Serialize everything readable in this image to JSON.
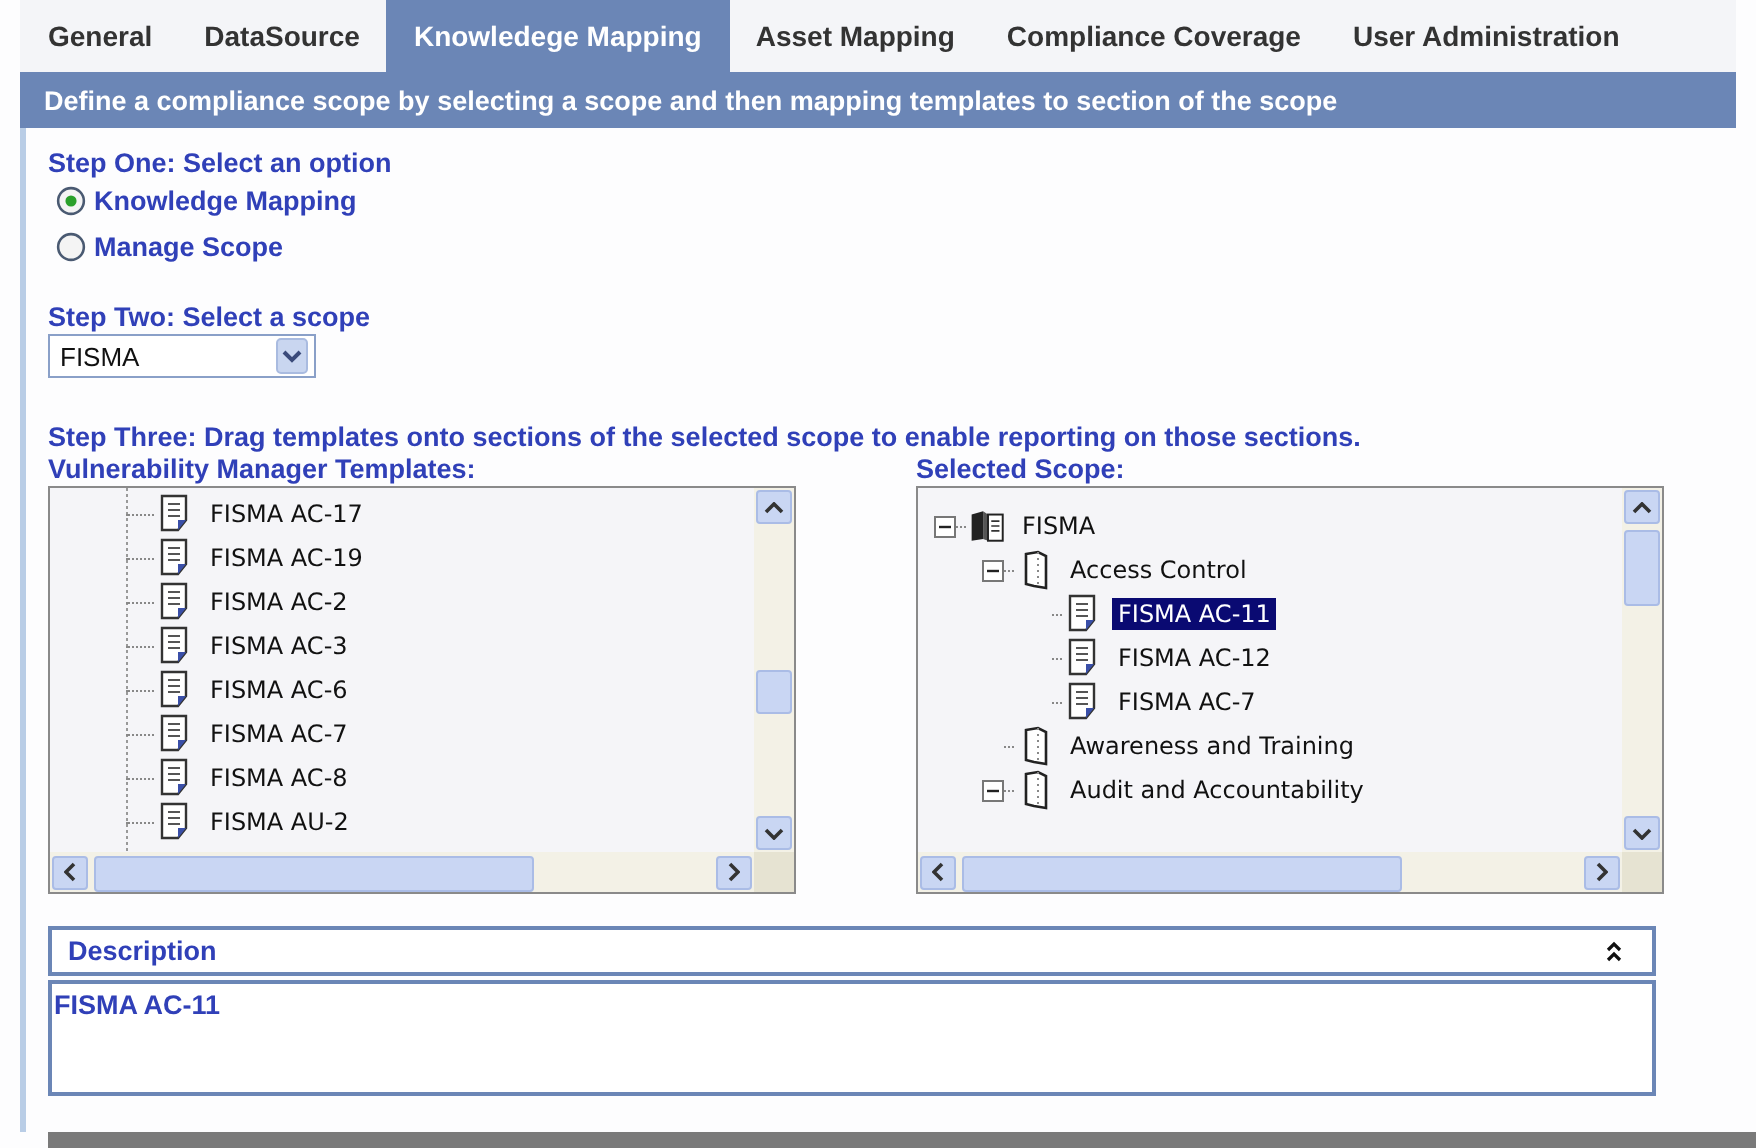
{
  "tabs": [
    {
      "label": "General",
      "selected": false
    },
    {
      "label": "DataSource",
      "selected": false
    },
    {
      "label": "Knowledege Mapping",
      "selected": true
    },
    {
      "label": "Asset Mapping",
      "selected": false
    },
    {
      "label": "Compliance Coverage",
      "selected": false
    },
    {
      "label": "User Administration",
      "selected": false
    }
  ],
  "banner": "Define a compliance scope by selecting a scope and then mapping templates to section of the scope",
  "step_one": {
    "label": "Step One: Select an option",
    "options": [
      {
        "label": "Knowledge Mapping",
        "selected": true
      },
      {
        "label": "Manage Scope",
        "selected": false
      }
    ]
  },
  "step_two": {
    "label": "Step Two: Select a scope",
    "value": "FISMA"
  },
  "step_three": {
    "label": "Step Three: Drag templates onto sections of the selected scope to enable reporting on those sections."
  },
  "templates": {
    "label": "Vulnerability Manager Templates:",
    "items": [
      {
        "label": "FISMA AC-17",
        "selected": false
      },
      {
        "label": "FISMA AC-19",
        "selected": false
      },
      {
        "label": "FISMA AC-2",
        "selected": false
      },
      {
        "label": "FISMA AC-3",
        "selected": false
      },
      {
        "label": "FISMA AC-6",
        "selected": false
      },
      {
        "label": "FISMA AC-7",
        "selected": false
      },
      {
        "label": "FISMA AC-8",
        "selected": false
      },
      {
        "label": "FISMA AU-2",
        "selected": false
      }
    ]
  },
  "scope": {
    "label": "Selected Scope:",
    "tree": [
      {
        "label": "FISMA",
        "kind": "book",
        "expanded": true,
        "selected": false,
        "children": [
          {
            "label": "Access Control",
            "kind": "section",
            "expanded": true,
            "selected": false,
            "children": [
              {
                "label": "FISMA AC-11",
                "kind": "template",
                "selected": true
              },
              {
                "label": "FISMA AC-12",
                "kind": "template",
                "selected": false
              },
              {
                "label": "FISMA AC-7",
                "kind": "template",
                "selected": false
              }
            ]
          },
          {
            "label": "Awareness and Training",
            "kind": "section",
            "selected": false
          },
          {
            "label": "Audit and Accountability",
            "kind": "section",
            "expanded": true,
            "selected": false
          }
        ]
      }
    ]
  },
  "description": {
    "title": "Description",
    "text": "FISMA AC-11"
  }
}
